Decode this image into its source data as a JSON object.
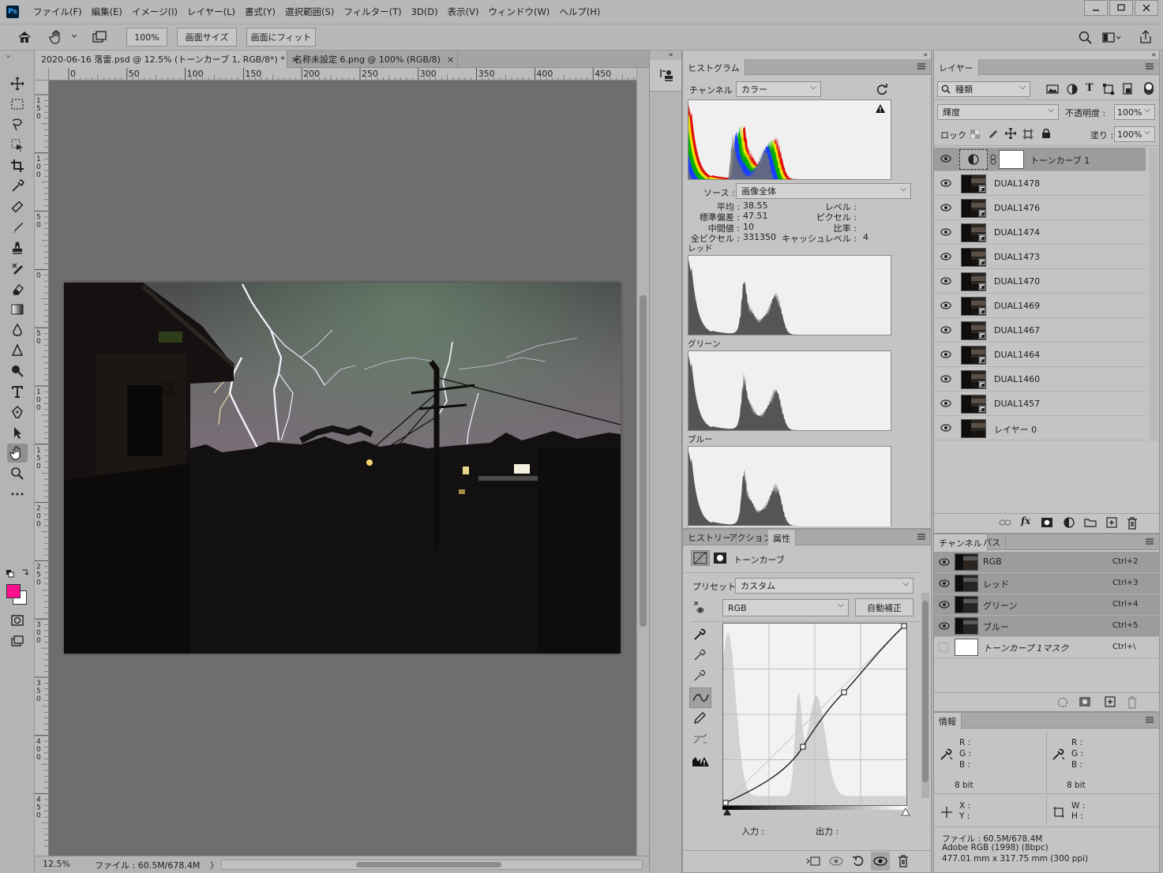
{
  "menubar": {
    "logo": "Ps",
    "items": [
      "ファイル(F)",
      "編集(E)",
      "イメージ(I)",
      "レイヤー(L)",
      "書式(Y)",
      "選択範囲(S)",
      "フィルター(T)",
      "3D(D)",
      "表示(V)",
      "ウィンドウ(W)",
      "ヘルプ(H)"
    ]
  },
  "options": {
    "zoom_btn": "100%",
    "screen_size_btn": "画面サイズ",
    "fit_btn": "画面にフィット"
  },
  "tabs": [
    {
      "label": "2020-06-16 落雷.psd @ 12.5% (トーンカーブ 1, RGB/8*) *",
      "close": "×"
    },
    {
      "label": "名称未設定 6.png @ 100% (RGB/8)",
      "close": "×"
    }
  ],
  "ruler": {
    "h_ticks": [
      "0",
      "50",
      "100",
      "150",
      "200",
      "250",
      "300",
      "350",
      "400",
      "450"
    ],
    "v_ticks": [
      "150",
      "100",
      "50",
      "0",
      "50",
      "100",
      "150",
      "200",
      "250",
      "300",
      "350",
      "400",
      "450"
    ]
  },
  "status": {
    "zoom": "12.5%",
    "file": "ファイル : 60.5M/678.4M",
    "arrow": "〉"
  },
  "histogram": {
    "tab": "ヒストグラム",
    "channel_label": "チャンネル :",
    "channel_value": "カラー",
    "source_label": "ソース :",
    "source_value": "画像全体",
    "stats": [
      {
        "label": "平均 :",
        "value": "38.55"
      },
      {
        "label": "標準偏差 :",
        "value": "47.51"
      },
      {
        "label": "中間値 :",
        "value": "10"
      },
      {
        "label": "全ピクセル :",
        "value": "331350"
      }
    ],
    "stats_right": [
      {
        "label": "レベル :",
        "value": ""
      },
      {
        "label": "ピクセル :",
        "value": ""
      },
      {
        "label": "比率 :",
        "value": ""
      },
      {
        "label": "キャッシュレベル :",
        "value": "4"
      }
    ],
    "red_label": "レッド",
    "green_label": "グリーン",
    "blue_label": "ブルー"
  },
  "props": {
    "tabs": [
      "ヒストリー",
      "アクション",
      "属性"
    ],
    "title": "トーンカーブ",
    "preset_label": "プリセット :",
    "preset_value": "カスタム",
    "channel_value": "RGB",
    "auto_btn": "自動補正",
    "input_label": "入力 :",
    "output_label": "出力 :"
  },
  "layers": {
    "tab": "レイヤー",
    "filter_value": "種類",
    "blend_value": "輝度",
    "opacity_label": "不透明度 :",
    "opacity_value": "100%",
    "lock_label": "ロック :",
    "fill_label": "塗り :",
    "fill_value": "100%",
    "rows": [
      {
        "name": "トーンカーブ 1"
      },
      {
        "name": "DUAL1478"
      },
      {
        "name": "DUAL1476"
      },
      {
        "name": "DUAL1474"
      },
      {
        "name": "DUAL1473"
      },
      {
        "name": "DUAL1470"
      },
      {
        "name": "DUAL1469"
      },
      {
        "name": "DUAL1467"
      },
      {
        "name": "DUAL1464"
      },
      {
        "name": "DUAL1460"
      },
      {
        "name": "DUAL1457"
      },
      {
        "name": "レイヤー 0"
      }
    ]
  },
  "channels": {
    "tabs": [
      "チャンネル",
      "パス"
    ],
    "rows": [
      {
        "name": "RGB",
        "key": "Ctrl+2"
      },
      {
        "name": "レッド",
        "key": "Ctrl+3"
      },
      {
        "name": "グリーン",
        "key": "Ctrl+4"
      },
      {
        "name": "ブルー",
        "key": "Ctrl+5"
      },
      {
        "name": "トーンカーブ 1マスク",
        "key": "Ctrl+\\"
      }
    ]
  },
  "info": {
    "tab": "情報",
    "r": "R :",
    "g": "G :",
    "b": "B :",
    "bits": "8 bit",
    "x": "X :",
    "y": "Y :",
    "w": "W :",
    "h": "H :",
    "file": "ファイル : 60.5M/678.4M",
    "profile": "Adobe RGB (1998) (8bpc)",
    "dims": "477.01 mm x 317.75 mm (300 ppi)"
  },
  "colors": {
    "foreground": "#ff0f8f",
    "background": "#ffffff"
  }
}
